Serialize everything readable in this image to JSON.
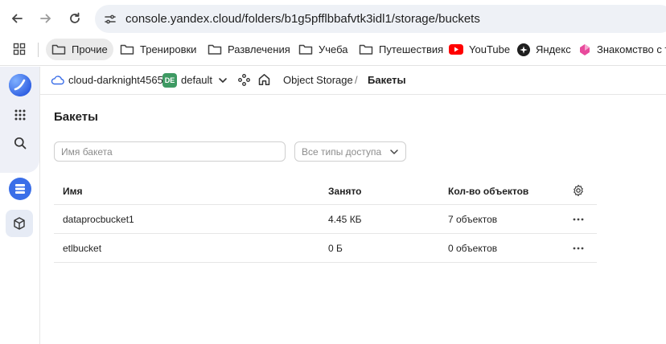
{
  "browser": {
    "url": "console.yandex.cloud/folders/b1g5pfflbbafvtk3idl1/storage/buckets",
    "bookmarks": [
      {
        "label": "Прочие",
        "icon": "folder-icon"
      },
      {
        "label": "Тренировки",
        "icon": "folder-icon"
      },
      {
        "label": "Развлечения",
        "icon": "folder-icon"
      },
      {
        "label": "Учеба",
        "icon": "folder-icon"
      },
      {
        "label": "Путешествия",
        "icon": "folder-icon"
      },
      {
        "label": "YouTube",
        "icon": "youtube-icon"
      },
      {
        "label": "Яндекс",
        "icon": "yandex-icon"
      },
      {
        "label": "Знакомство с то",
        "icon": "bookmark-logo-icon"
      }
    ]
  },
  "breadcrumb": {
    "cloud": "cloud-darknight4565",
    "folder_badge": "DE",
    "folder": "default",
    "service": "Object Storage",
    "separator": "/",
    "current": "Бакеты"
  },
  "main": {
    "title": "Бакеты",
    "search_placeholder": "Имя бакета",
    "access_filter": "Все типы доступа",
    "columns": {
      "name": "Имя",
      "size": "Занято",
      "count": "Кол-во объектов"
    },
    "rows": [
      {
        "name": "dataprocbucket1",
        "size": "4.45 КБ",
        "count": "7 объектов"
      },
      {
        "name": "etlbucket",
        "size": "0 Б",
        "count": "0 объектов"
      }
    ]
  },
  "colors": {
    "accent": "#3a6ee8",
    "folder_badge": "#3e9a63",
    "youtube": "#ff0000"
  }
}
